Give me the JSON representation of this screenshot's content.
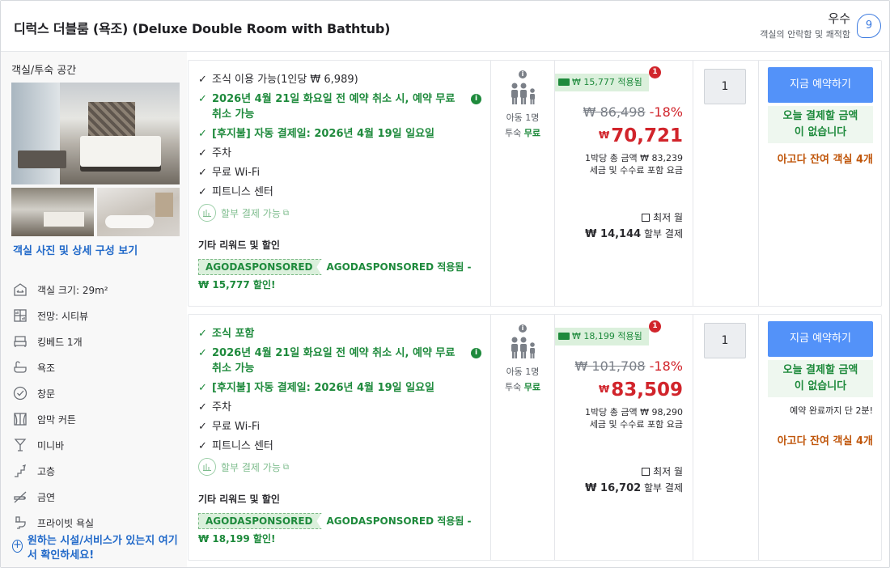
{
  "header": {
    "room_title": "디럭스 더블룸 (욕조) (Deluxe Double Room with Bathtub)",
    "rating_word": "우수",
    "rating_sub": "객실의 안락함 및 쾌적함",
    "rating_score": "9"
  },
  "left": {
    "heading": "객실/투숙 공간",
    "view_photos": "객실 사진 및 상세 구성 보기",
    "features": [
      {
        "label": "객실 크기: 29m²",
        "icon": "room-size-icon"
      },
      {
        "label": "전망: 시티뷰",
        "icon": "city-view-icon"
      },
      {
        "label": "킹베드 1개",
        "icon": "bed-icon"
      },
      {
        "label": "욕조",
        "icon": "bathtub-icon"
      },
      {
        "label": "창문",
        "icon": "window-icon"
      },
      {
        "label": "암막 커튼",
        "icon": "blackout-curtain-icon"
      },
      {
        "label": "미니바",
        "icon": "minibar-icon"
      },
      {
        "label": "고층",
        "icon": "high-floor-icon"
      },
      {
        "label": "금연",
        "icon": "no-smoking-icon"
      },
      {
        "label": "프라이빗 욕실",
        "icon": "private-bathroom-icon"
      }
    ],
    "more_facilities": "원하는 시설/서비스가 있는지 여기서 확인하세요!"
  },
  "offers": [
    {
      "perks": [
        {
          "text": "조식 이용 가능(1인당 ₩ 6,989)",
          "green": false
        },
        {
          "text": "2026년 4월 21일 화요일 전 예약 취소 시, 예약 무료 취소 가능",
          "green": true,
          "info": true
        },
        {
          "text": "[후지불] 자동 결제일: 2026년 4월 19일 일요일",
          "green": true
        },
        {
          "text": "주차",
          "green": false
        },
        {
          "text": "무료 Wi-Fi",
          "green": false
        },
        {
          "text": "피트니스 센터",
          "green": false
        }
      ],
      "installment": "할부 결제 가능",
      "rewards_heading": "기타 리워드 및 할인",
      "sponsor_tag": "AGODASPONSORED",
      "sponsor_text": "AGODASPONSORED 적용됨 - ₩ 15,777 할인!",
      "child_capacity": "아동 1명",
      "stay_label": "투숙",
      "stay_free": "무료",
      "coupon": "₩ 15,777 적용됨",
      "coupon_badge": "1",
      "original_price": "₩ 86,498",
      "discount": "-18%",
      "currency": "₩",
      "final_price": "70,721",
      "per_night_total": "1박당 총 금액 ₩ 83,239",
      "tax_note": "세금 및 수수료 포함 요금",
      "lowest_monthly": "최저 월",
      "monthly_amount": "₩ 14,144",
      "monthly_suffix": "할부 결제",
      "quantity": "1",
      "book_button": "지금 예약하기",
      "pay_now_line1": "오늘 결제할 금액",
      "pay_now_line2": "이 없습니다",
      "countdown": "",
      "rooms_left": "아고다 잔여 객실 4개"
    },
    {
      "perks": [
        {
          "text": "조식 포함",
          "green": true
        },
        {
          "text": "2026년 4월 21일 화요일 전 예약 취소 시, 예약 무료 취소 가능",
          "green": true,
          "info": true
        },
        {
          "text": "[후지불] 자동 결제일: 2026년 4월 19일 일요일",
          "green": true
        },
        {
          "text": "주차",
          "green": false
        },
        {
          "text": "무료 Wi-Fi",
          "green": false
        },
        {
          "text": "피트니스 센터",
          "green": false
        }
      ],
      "installment": "할부 결제 가능",
      "rewards_heading": "기타 리워드 및 할인",
      "sponsor_tag": "AGODASPONSORED",
      "sponsor_text": "AGODASPONSORED 적용됨 - ₩ 18,199 할인!",
      "child_capacity": "아동 1명",
      "stay_label": "투숙",
      "stay_free": "무료",
      "coupon": "₩ 18,199 적용됨",
      "coupon_badge": "1",
      "original_price": "₩ 101,708",
      "discount": "-18%",
      "currency": "₩",
      "final_price": "83,509",
      "per_night_total": "1박당 총 금액 ₩ 98,290",
      "tax_note": "세금 및 수수료 포함 요금",
      "lowest_monthly": "최저 월",
      "monthly_amount": "₩ 16,702",
      "monthly_suffix": "할부 결제",
      "quantity": "1",
      "book_button": "지금 예약하기",
      "pay_now_line1": "오늘 결제할 금액",
      "pay_now_line2": "이 없습니다",
      "countdown": "예약 완료까지 단 2분!",
      "rooms_left": "아고다 잔여 객실 4개"
    }
  ],
  "colors": {
    "accent_blue": "#5392f9",
    "link_blue": "#2169c9",
    "green": "#1e8a3c",
    "price_red": "#d1242b",
    "urgency_orange": "#c0560b"
  }
}
